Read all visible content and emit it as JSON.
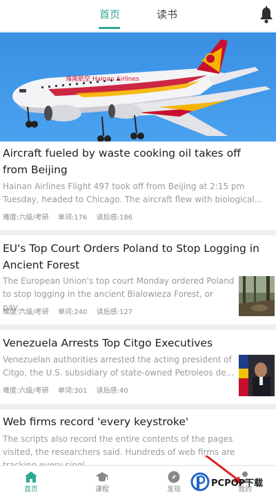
{
  "header": {
    "tabs": [
      {
        "label": "首页",
        "active": true
      },
      {
        "label": "读书",
        "active": false
      }
    ],
    "notification_icon": "bell-icon",
    "accent_color": "#2fa894"
  },
  "articles": [
    {
      "title": "Aircraft fueled by waste cooking oil takes off from Beijing",
      "summary": "Hainan Airlines Flight 497 took off from Beijing at 2:15 pm Tuesday, headed to Chicago. The aircraft flew with biological...",
      "level": "难度:六级/考研",
      "words": "单词:176",
      "read": "读后感:186",
      "image_text": "海南航空 Hainan Airlines"
    },
    {
      "title": "EU's Top Court Orders Poland to Stop Logging in Ancient Forest",
      "summary": "The European Union's top court Monday ordered Poland to stop logging in the ancient Bialowieza Forest, or pay...",
      "level": "难度:六级/考研",
      "words": "单词:240",
      "read": "读后感:127"
    },
    {
      "title": "Venezuela Arrests Top Citgo Executives",
      "summary": "Venezuelan authorities arrested the acting president of Citgo, the U.S. subsidiary of state-owned Petroleos de...",
      "level": "难度:六级/考研",
      "words": "单词:301",
      "read": "读后感:40"
    },
    {
      "title": "Web firms record 'every keystroke'",
      "summary": "The scripts also record the entire contents of the pages visited, the researchers said. Hundreds of web firms are tracking every singl..."
    }
  ],
  "bottom_nav": [
    {
      "label": "首页",
      "icon": "home-icon",
      "active": true
    },
    {
      "label": "课程",
      "icon": "graduation-cap-icon",
      "active": false
    },
    {
      "label": "发现",
      "icon": "compass-icon",
      "active": false
    },
    {
      "label": "我的",
      "icon": "person-icon",
      "active": false
    }
  ],
  "watermark": {
    "brand": "PCPOP下载"
  }
}
